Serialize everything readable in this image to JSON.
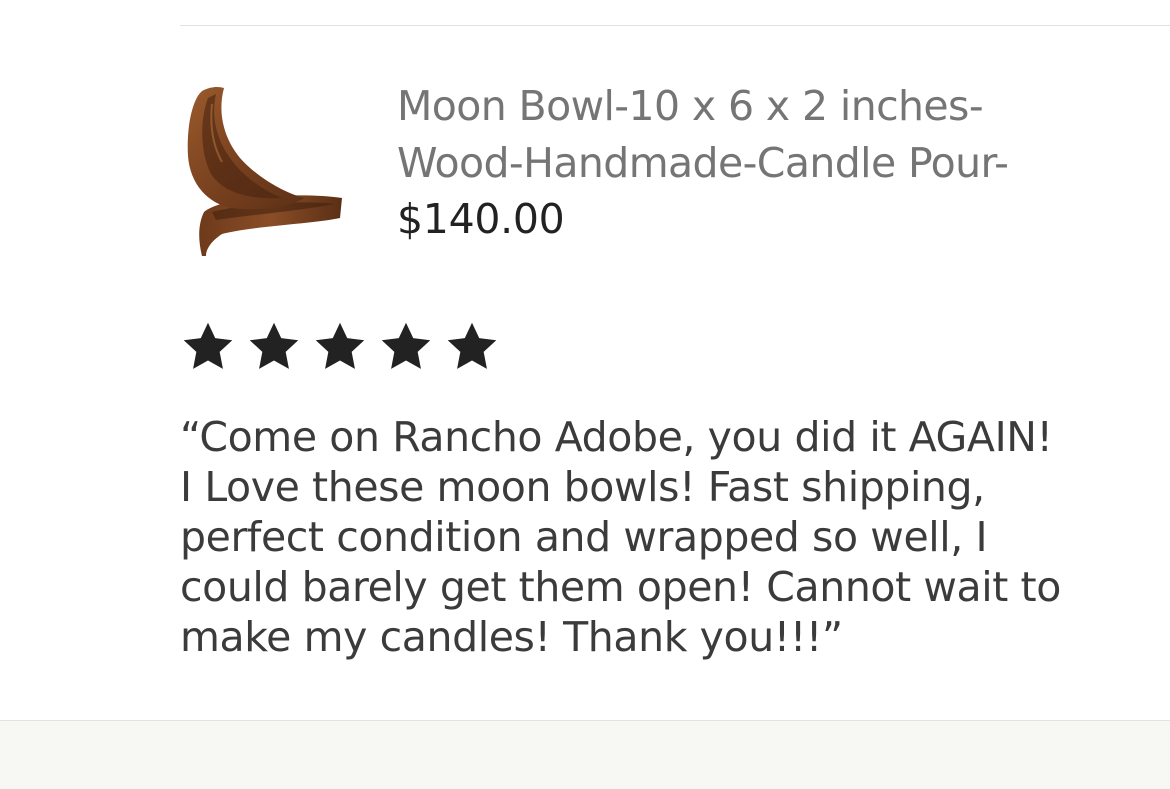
{
  "listing": {
    "title": "Moon Bowl-10 x 6 x 2 inches-\nWood-Handmade-Candle Pour-",
    "price": "$140.00",
    "thumbnail_icon": "wooden-moon-bowl-image"
  },
  "review": {
    "rating": 5,
    "rating_max": 5,
    "star_color": "#222222",
    "text": "“Come on Rancho Adobe, you did it AGAIN!\nI Love these moon bowls! Fast shipping,\nperfect condition and wrapped so well, I\ncould barely get them open! Cannot wait to\nmake my candles! Thank you!!!”"
  },
  "colors": {
    "title_gray": "#757575",
    "text_dark": "#222222",
    "footer_bg": "#f7f7f3"
  }
}
